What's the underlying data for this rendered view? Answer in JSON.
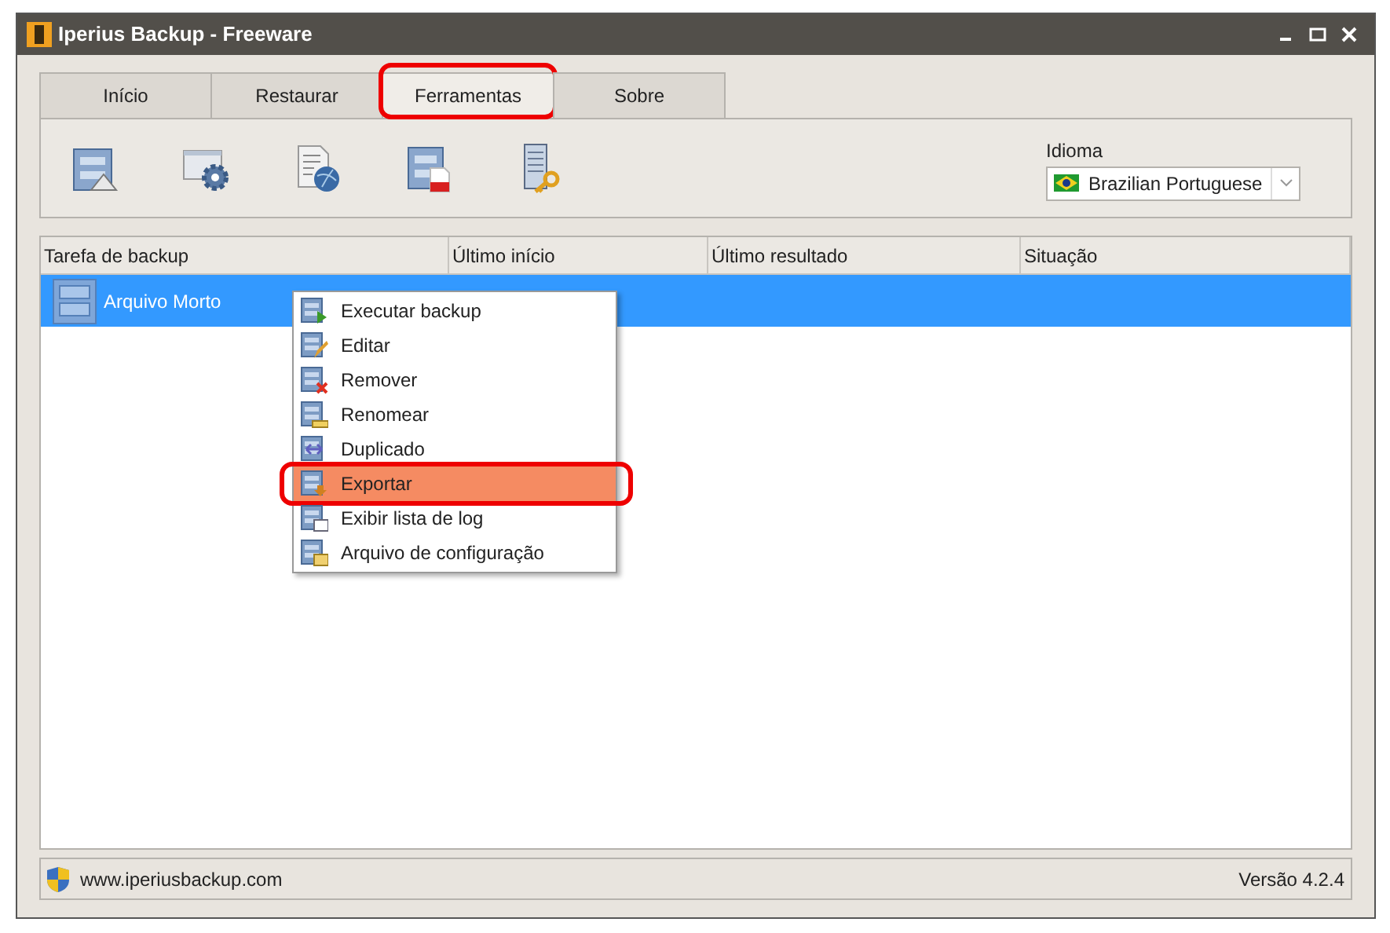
{
  "window": {
    "title": "Iperius Backup - Freeware"
  },
  "tabs": [
    {
      "label": "Início",
      "selected": false,
      "annotated": false
    },
    {
      "label": "Restaurar",
      "selected": false,
      "annotated": false
    },
    {
      "label": "Ferramentas",
      "selected": true,
      "annotated": true
    },
    {
      "label": "Sobre",
      "selected": false,
      "annotated": false
    }
  ],
  "language": {
    "label": "Idioma",
    "value": "Brazilian Portuguese"
  },
  "table": {
    "columns": [
      "Tarefa de backup",
      "Último início",
      "Último resultado",
      "Situação"
    ],
    "rows": [
      {
        "name": "Arquivo Morto",
        "selected": true
      }
    ]
  },
  "context_menu": [
    {
      "label": "Executar backup",
      "kind": "run",
      "annotated": false,
      "selected": false
    },
    {
      "label": "Editar",
      "kind": "edit",
      "annotated": false,
      "selected": false
    },
    {
      "label": "Remover",
      "kind": "remove",
      "annotated": false,
      "selected": false
    },
    {
      "label": "Renomear",
      "kind": "rename",
      "annotated": false,
      "selected": false
    },
    {
      "label": "Duplicado",
      "kind": "duplicate",
      "annotated": false,
      "selected": false
    },
    {
      "label": "Exportar",
      "kind": "export",
      "annotated": true,
      "selected": true
    },
    {
      "label": "Exibir lista de log",
      "kind": "log",
      "annotated": false,
      "selected": false
    },
    {
      "label": "Arquivo de configuração",
      "kind": "config",
      "annotated": false,
      "selected": false
    }
  ],
  "status_bar": {
    "link": "www.iperiusbackup.com",
    "version": "Versão 4.2.4"
  }
}
